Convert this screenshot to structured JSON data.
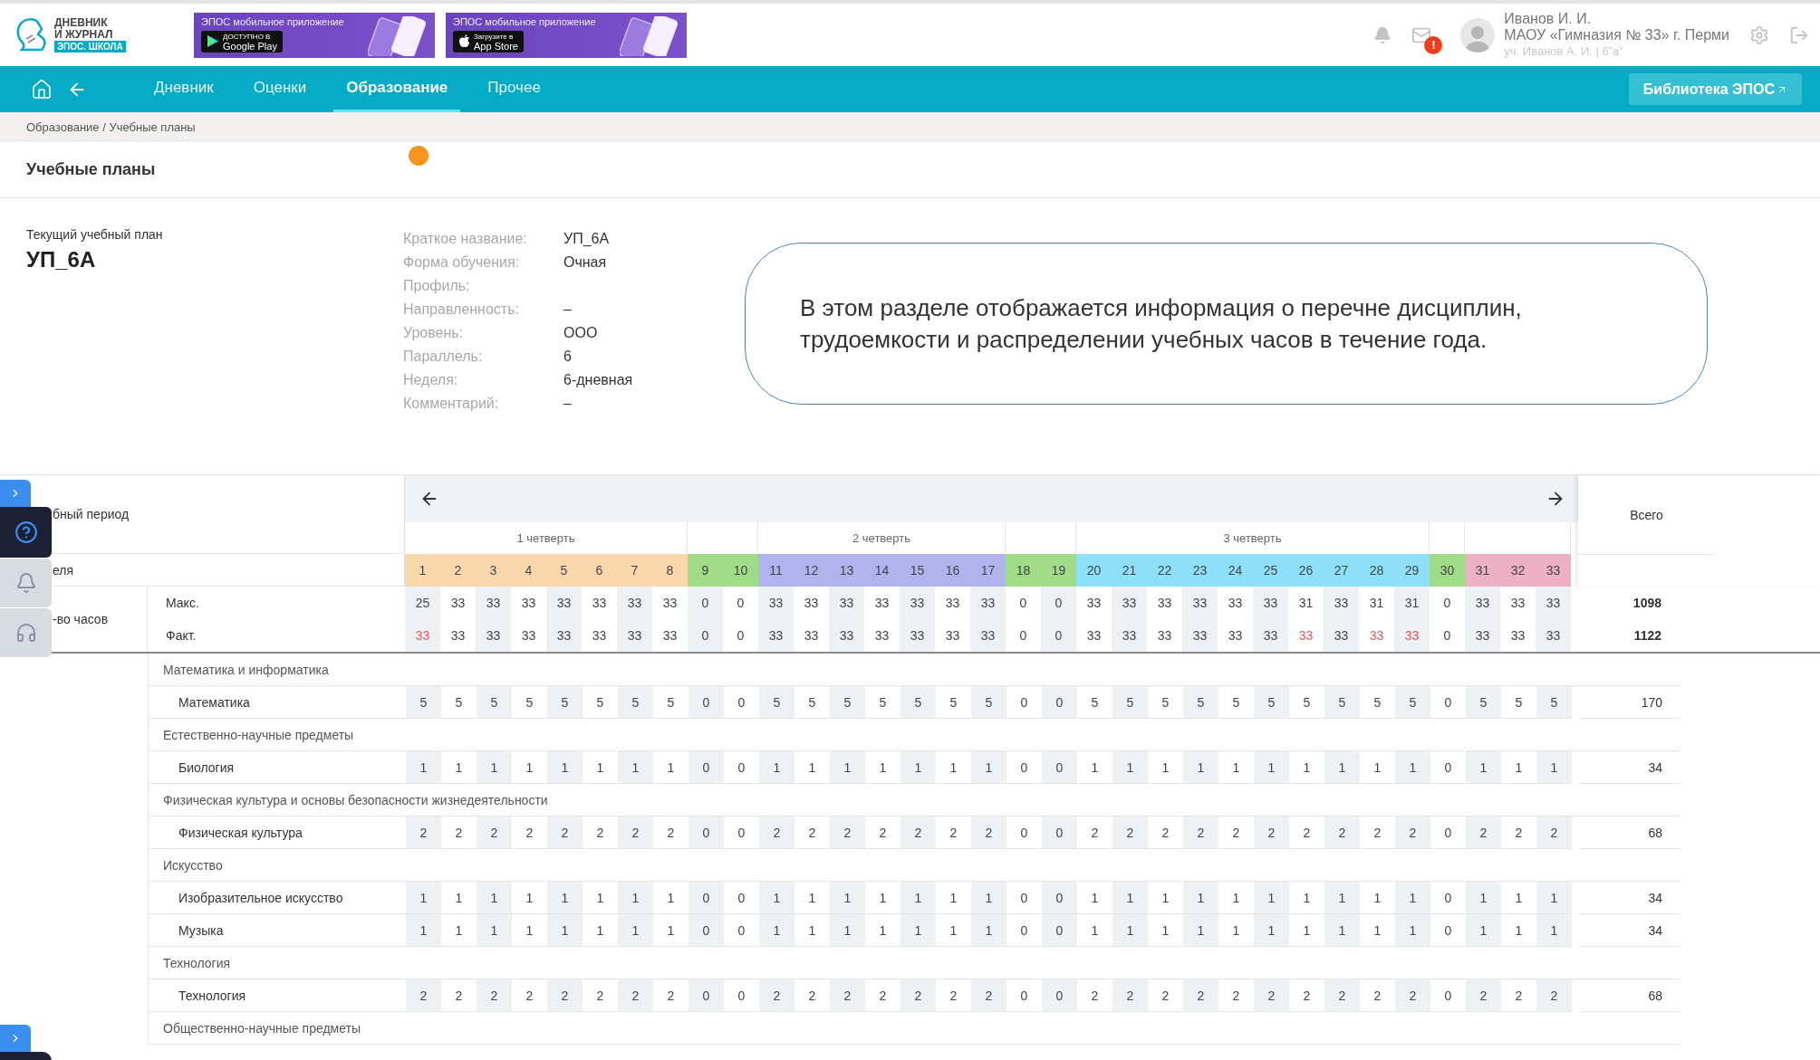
{
  "header": {
    "logo": {
      "line1": "ДНЕВНИК",
      "line2": "И ЖУРНАЛ",
      "badge": "ЭПОС. ШКОЛА"
    },
    "banners": [
      {
        "kind": "google",
        "title": "ЭПОС мобильное приложение",
        "store_caption": "ДОСТУПНО В",
        "store": "Google Play"
      },
      {
        "kind": "apple",
        "title": "ЭПОС мобильное приложение",
        "store_caption": "Загрузите в",
        "store": "App Store"
      }
    ],
    "mail_badge": "!",
    "user": {
      "name": "Иванов И. И.",
      "school": "МАОУ «Гимназия № 33» г. Перми",
      "role": "уч. Иванов А. И. | 6”а”"
    }
  },
  "nav": {
    "tabs": [
      {
        "label": "Дневник",
        "selected": false
      },
      {
        "label": "Оценки",
        "selected": false
      },
      {
        "label": "Образование",
        "selected": true
      },
      {
        "label": "Прочее",
        "selected": false
      }
    ],
    "library_button": "Библиотека ЭПОС"
  },
  "breadcrumb": "Образование / Учебные планы",
  "page_title": "Учебные планы",
  "plan": {
    "caption": "Текущий учебный план",
    "name": "УП_6А",
    "fields": [
      {
        "label": "Краткое название:",
        "value": "УП_6А"
      },
      {
        "label": "Форма обучения:",
        "value": "Очная"
      },
      {
        "label": "Профиль:"
      },
      {
        "label": "Направленность:",
        "value": "–"
      },
      {
        "label": "Уровень:",
        "value": "ООО"
      },
      {
        "label": "Параллель:",
        "value": "6"
      },
      {
        "label": "Неделя:",
        "value": "6-дневная"
      },
      {
        "label": "Комментарий:",
        "value": "–"
      }
    ]
  },
  "callout": "В этом разделе отображается информация о перечне дисциплин, трудоемкости и распределении учебных часов в течение года.",
  "table": {
    "period_label": "бный период",
    "week_label": "еля",
    "total_label": "Всего",
    "quarters": [
      {
        "kind": "quarter",
        "label": "1 четверть",
        "weeks": [
          {
            "label": "1",
            "color": "#f8d8aa"
          },
          {
            "label": "2",
            "color": "#f8d8aa"
          },
          {
            "label": "3",
            "color": "#f8d8aa"
          },
          {
            "label": "4",
            "color": "#f8d8aa"
          },
          {
            "label": "5",
            "color": "#f8d8aa"
          },
          {
            "label": "6",
            "color": "#f8d8aa"
          },
          {
            "label": "7",
            "color": "#f8d8aa"
          },
          {
            "label": "8",
            "color": "#f8d8aa"
          }
        ]
      },
      {
        "kind": "break",
        "weeks": [
          {
            "label": "9",
            "color": "#a0dc88"
          },
          {
            "label": "10",
            "color": "#a0dc88"
          }
        ]
      },
      {
        "kind": "quarter",
        "label": "2 четверть",
        "weeks": [
          {
            "label": "11",
            "color": "#b1b3ee"
          },
          {
            "label": "12",
            "color": "#b1b3ee"
          },
          {
            "label": "13",
            "color": "#b1b3ee"
          },
          {
            "label": "14",
            "color": "#b1b3ee"
          },
          {
            "label": "15",
            "color": "#b1b3ee"
          },
          {
            "label": "16",
            "color": "#b1b3ee"
          },
          {
            "label": "17",
            "color": "#b1b3ee"
          }
        ]
      },
      {
        "kind": "break",
        "weeks": [
          {
            "label": "18",
            "color": "#a0dc88"
          },
          {
            "label": "19",
            "color": "#a0dc88"
          }
        ]
      },
      {
        "kind": "quarter",
        "label": "3 четверть",
        "weeks": [
          {
            "label": "20",
            "color": "#8ce0fa"
          },
          {
            "label": "21",
            "color": "#8ce0fa"
          },
          {
            "label": "22",
            "color": "#8ce0fa"
          },
          {
            "label": "23",
            "color": "#8ce0fa"
          },
          {
            "label": "24",
            "color": "#8ce0fa"
          },
          {
            "label": "25",
            "color": "#8ce0fa"
          },
          {
            "label": "26",
            "color": "#8ce0fa"
          },
          {
            "label": "27",
            "color": "#8ce0fa"
          },
          {
            "label": "28",
            "color": "#8ce0fa"
          },
          {
            "label": "29",
            "color": "#8ce0fa"
          }
        ]
      },
      {
        "kind": "break",
        "weeks": [
          {
            "label": "30",
            "color": "#a0dc88"
          }
        ]
      },
      {
        "kind": "break",
        "weeks": [
          {
            "label": "31",
            "color": "#eeb0c4"
          },
          {
            "label": "32",
            "color": "#eeb0c4"
          },
          {
            "label": "33",
            "color": "#eeb0c4"
          }
        ]
      }
    ],
    "hours": {
      "label": "-во часов",
      "rows": [
        {
          "label": "Макс.",
          "values": [
            "25",
            "33",
            "33",
            "33",
            "33",
            "33",
            "33",
            "33",
            "0",
            "0",
            "33",
            "33",
            "33",
            "33",
            "33",
            "33",
            "33",
            "0",
            "0",
            "33",
            "33",
            "33",
            "33",
            "33",
            "33",
            "31",
            "33",
            "31",
            "31",
            "0",
            "33",
            "33",
            "33"
          ],
          "exceeded": [
            false,
            false,
            false,
            false,
            false,
            false,
            false,
            false,
            false,
            false,
            false,
            false,
            false,
            false,
            false,
            false,
            false,
            false,
            false,
            false,
            false,
            false,
            false,
            false,
            false,
            false,
            false,
            false,
            false,
            false,
            false,
            false,
            false
          ],
          "total": "1098"
        },
        {
          "label": "Факт.",
          "values": [
            "33",
            "33",
            "33",
            "33",
            "33",
            "33",
            "33",
            "33",
            "0",
            "0",
            "33",
            "33",
            "33",
            "33",
            "33",
            "33",
            "33",
            "0",
            "0",
            "33",
            "33",
            "33",
            "33",
            "33",
            "33",
            "33",
            "33",
            "33",
            "33",
            "0",
            "33",
            "33",
            "33"
          ],
          "exceeded": [
            true,
            false,
            false,
            false,
            false,
            false,
            false,
            false,
            false,
            false,
            false,
            false,
            false,
            false,
            false,
            false,
            false,
            false,
            false,
            false,
            false,
            false,
            false,
            false,
            false,
            true,
            false,
            true,
            true,
            false,
            false,
            false,
            false
          ],
          "total": "1122"
        }
      ]
    },
    "groups": [
      {
        "name": "Математика и информатика",
        "subjects": [
          {
            "name": "Математика",
            "values": [
              "5",
              "5",
              "5",
              "5",
              "5",
              "5",
              "5",
              "5",
              "0",
              "0",
              "5",
              "5",
              "5",
              "5",
              "5",
              "5",
              "5",
              "0",
              "0",
              "5",
              "5",
              "5",
              "5",
              "5",
              "5",
              "5",
              "5",
              "5",
              "5",
              "0",
              "5",
              "5",
              "5"
            ],
            "total": "170"
          }
        ]
      },
      {
        "name": "Естественно-научные предметы",
        "subjects": [
          {
            "name": "Биология",
            "values": [
              "1",
              "1",
              "1",
              "1",
              "1",
              "1",
              "1",
              "1",
              "0",
              "0",
              "1",
              "1",
              "1",
              "1",
              "1",
              "1",
              "1",
              "0",
              "0",
              "1",
              "1",
              "1",
              "1",
              "1",
              "1",
              "1",
              "1",
              "1",
              "1",
              "0",
              "1",
              "1",
              "1"
            ],
            "total": "34"
          }
        ]
      },
      {
        "name": "Физическая культура и основы безопасности жизнедеятельности",
        "subjects": [
          {
            "name": "Физическая культура",
            "values": [
              "2",
              "2",
              "2",
              "2",
              "2",
              "2",
              "2",
              "2",
              "0",
              "0",
              "2",
              "2",
              "2",
              "2",
              "2",
              "2",
              "2",
              "0",
              "0",
              "2",
              "2",
              "2",
              "2",
              "2",
              "2",
              "2",
              "2",
              "2",
              "2",
              "0",
              "2",
              "2",
              "2"
            ],
            "total": "68"
          }
        ]
      },
      {
        "name": "Искусство",
        "subjects": [
          {
            "name": "Изобразительное искусство",
            "values": [
              "1",
              "1",
              "1",
              "1",
              "1",
              "1",
              "1",
              "1",
              "0",
              "0",
              "1",
              "1",
              "1",
              "1",
              "1",
              "1",
              "1",
              "0",
              "0",
              "1",
              "1",
              "1",
              "1",
              "1",
              "1",
              "1",
              "1",
              "1",
              "1",
              "0",
              "1",
              "1",
              "1"
            ],
            "total": "34"
          },
          {
            "name": "Музыка",
            "values": [
              "1",
              "1",
              "1",
              "1",
              "1",
              "1",
              "1",
              "1",
              "0",
              "0",
              "1",
              "1",
              "1",
              "1",
              "1",
              "1",
              "1",
              "0",
              "0",
              "1",
              "1",
              "1",
              "1",
              "1",
              "1",
              "1",
              "1",
              "1",
              "1",
              "0",
              "1",
              "1",
              "1"
            ],
            "total": "34"
          }
        ]
      },
      {
        "name": "Технология",
        "subjects": [
          {
            "name": "Технология",
            "values": [
              "2",
              "2",
              "2",
              "2",
              "2",
              "2",
              "2",
              "2",
              "0",
              "0",
              "2",
              "2",
              "2",
              "2",
              "2",
              "2",
              "2",
              "0",
              "0",
              "2",
              "2",
              "2",
              "2",
              "2",
              "2",
              "2",
              "2",
              "2",
              "2",
              "0",
              "2",
              "2",
              "2"
            ],
            "total": "68"
          }
        ]
      },
      {
        "name": "Общественно-научные предметы"
      }
    ]
  }
}
